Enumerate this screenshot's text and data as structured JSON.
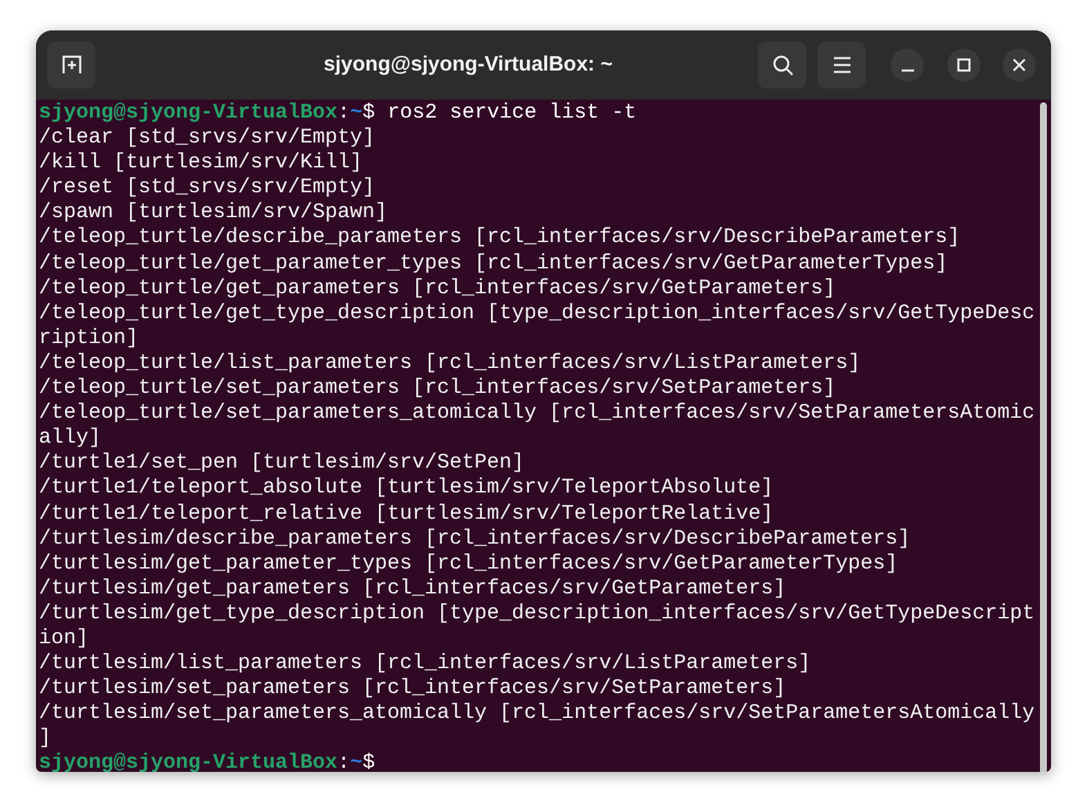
{
  "window": {
    "title": "sjyong@sjyong-VirtualBox: ~"
  },
  "terminal": {
    "lines": [
      {
        "kind": "prompt",
        "user_host": "sjyong@sjyong-VirtualBox",
        "separator": ":",
        "path": "~",
        "symbol": "$",
        "command": " ros2 service list -t"
      },
      {
        "kind": "output",
        "text": "/clear [std_srvs/srv/Empty]"
      },
      {
        "kind": "output",
        "text": "/kill [turtlesim/srv/Kill]"
      },
      {
        "kind": "output",
        "text": "/reset [std_srvs/srv/Empty]"
      },
      {
        "kind": "output",
        "text": "/spawn [turtlesim/srv/Spawn]"
      },
      {
        "kind": "output",
        "text": "/teleop_turtle/describe_parameters [rcl_interfaces/srv/DescribeParameters]"
      },
      {
        "kind": "output",
        "text": "/teleop_turtle/get_parameter_types [rcl_interfaces/srv/GetParameterTypes]"
      },
      {
        "kind": "output",
        "text": "/teleop_turtle/get_parameters [rcl_interfaces/srv/GetParameters]"
      },
      {
        "kind": "output",
        "text": "/teleop_turtle/get_type_description [type_description_interfaces/srv/GetTypeDesc"
      },
      {
        "kind": "output",
        "text": "ription]"
      },
      {
        "kind": "output",
        "text": "/teleop_turtle/list_parameters [rcl_interfaces/srv/ListParameters]"
      },
      {
        "kind": "output",
        "text": "/teleop_turtle/set_parameters [rcl_interfaces/srv/SetParameters]"
      },
      {
        "kind": "output",
        "text": "/teleop_turtle/set_parameters_atomically [rcl_interfaces/srv/SetParametersAtomic"
      },
      {
        "kind": "output",
        "text": "ally]"
      },
      {
        "kind": "output",
        "text": "/turtle1/set_pen [turtlesim/srv/SetPen]"
      },
      {
        "kind": "output",
        "text": "/turtle1/teleport_absolute [turtlesim/srv/TeleportAbsolute]"
      },
      {
        "kind": "output",
        "text": "/turtle1/teleport_relative [turtlesim/srv/TeleportRelative]"
      },
      {
        "kind": "output",
        "text": "/turtlesim/describe_parameters [rcl_interfaces/srv/DescribeParameters]"
      },
      {
        "kind": "output",
        "text": "/turtlesim/get_parameter_types [rcl_interfaces/srv/GetParameterTypes]"
      },
      {
        "kind": "output",
        "text": "/turtlesim/get_parameters [rcl_interfaces/srv/GetParameters]"
      },
      {
        "kind": "output",
        "text": "/turtlesim/get_type_description [type_description_interfaces/srv/GetTypeDescript"
      },
      {
        "kind": "output",
        "text": "ion]"
      },
      {
        "kind": "output",
        "text": "/turtlesim/list_parameters [rcl_interfaces/srv/ListParameters]"
      },
      {
        "kind": "output",
        "text": "/turtlesim/set_parameters [rcl_interfaces/srv/SetParameters]"
      },
      {
        "kind": "output",
        "text": "/turtlesim/set_parameters_atomically [rcl_interfaces/srv/SetParametersAtomically"
      },
      {
        "kind": "output",
        "text": "]"
      },
      {
        "kind": "prompt",
        "user_host": "sjyong@sjyong-VirtualBox",
        "separator": ":",
        "path": "~",
        "symbol": "$"
      }
    ]
  }
}
